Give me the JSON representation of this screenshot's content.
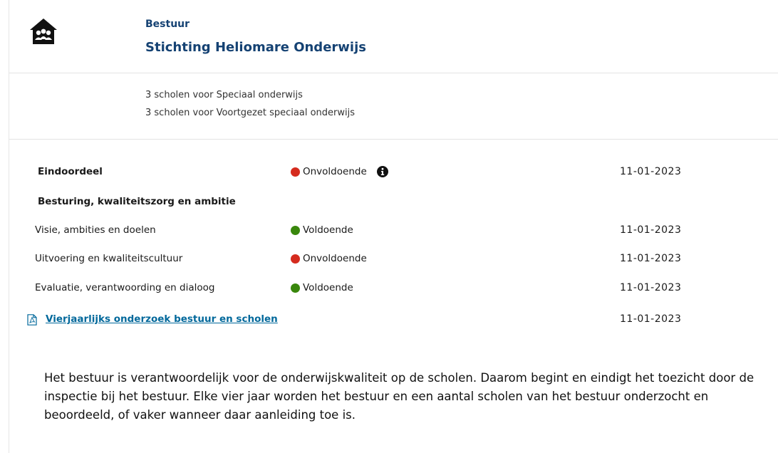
{
  "header": {
    "eyebrow": "Bestuur",
    "org_name": "Stichting Heliomare Onderwijs"
  },
  "schools": [
    "3 scholen voor Speciaal onderwijs",
    "3 scholen voor Voortgezet speciaal onderwijs"
  ],
  "judgements": [
    {
      "label": "Eindoordeel",
      "status": "Onvoldoende",
      "color": "#d52b1e",
      "date": "11-01-2023"
    },
    {
      "label": "Besturing, kwaliteitszorg en ambitie"
    },
    {
      "label": "Visie, ambities en doelen",
      "status": "Voldoende",
      "color": "#39870c",
      "date": "11-01-2023"
    },
    {
      "label": "Uitvoering en kwaliteitscultuur",
      "status": "Onvoldoende",
      "color": "#d52b1e",
      "date": "11-01-2023"
    },
    {
      "label": "Evaluatie, verantwoording en dialoog",
      "status": "Voldoende",
      "color": "#39870c",
      "date": "11-01-2023"
    }
  ],
  "report": {
    "link_label": "Vierjaarlijks onderzoek bestuur en scholen",
    "date": "11-01-2023"
  },
  "paragraph": "Het bestuur is verantwoordelijk voor de onderwijskwaliteit op de scholen. Daarom begint en eindigt het toezicht door de inspectie bij het bestuur. Elke vier jaar worden het bestuur en een aantal scholen van het bestuur onderzocht en beoordeeld, of vaker wanneer daar aanleiding toe is.",
  "icons": {
    "header": "school-board-house-icon",
    "info": "info-icon",
    "report": "pdf-document-icon"
  }
}
